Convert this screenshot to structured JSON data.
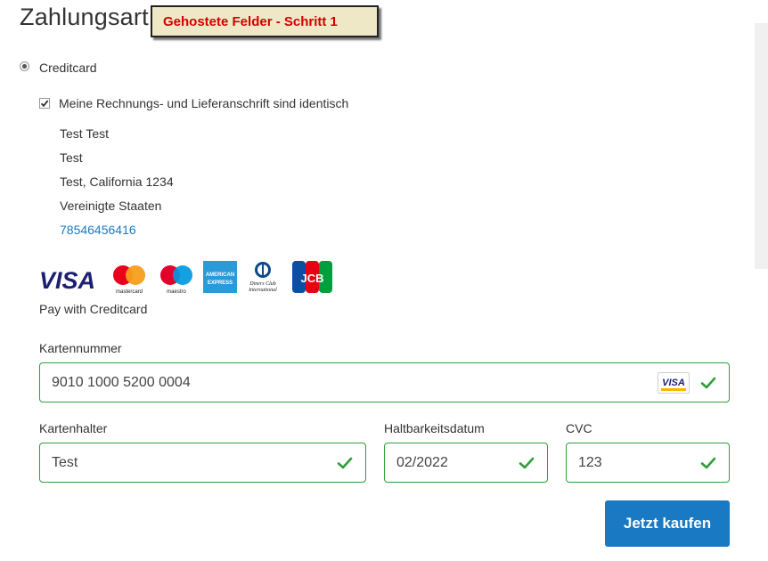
{
  "page": {
    "title": "Zahlungsart",
    "note": "Gehostete Felder - Schritt 1"
  },
  "payment_method": {
    "label": "Creditcard",
    "selected": true
  },
  "billing": {
    "same_address_label": "Meine Rechnungs- und Lieferanschrift sind identisch",
    "same_address_checked": true,
    "address_lines": [
      "Test Test",
      "Test",
      "Test, California 1234",
      "Vereinigte Staaten"
    ],
    "phone": "78546456416"
  },
  "card_logos": {
    "visa": "VISA",
    "mastercard": "mastercard",
    "maestro": "maestro",
    "amex_line1": "AMERICAN",
    "amex_line2": "EXPRESS",
    "diners_line1": "Diners Club",
    "diners_line2": "International",
    "jcb": "JCB"
  },
  "pay_with_label": "Pay with Creditcard",
  "form": {
    "card_number": {
      "label": "Kartennummer",
      "value": "9010 1000 5200 0004",
      "brand": "VISA"
    },
    "card_holder": {
      "label": "Kartenhalter",
      "value": "Test"
    },
    "expiry": {
      "label": "Haltbarkeitsdatum",
      "value": "02/2022"
    },
    "cvc": {
      "label": "CVC",
      "value": "123"
    }
  },
  "buy_button": "Jetzt kaufen",
  "colors": {
    "accent": "#1979c3",
    "valid": "#2e9f3a",
    "note_text": "#d40000",
    "note_bg": "#efe8c6"
  }
}
